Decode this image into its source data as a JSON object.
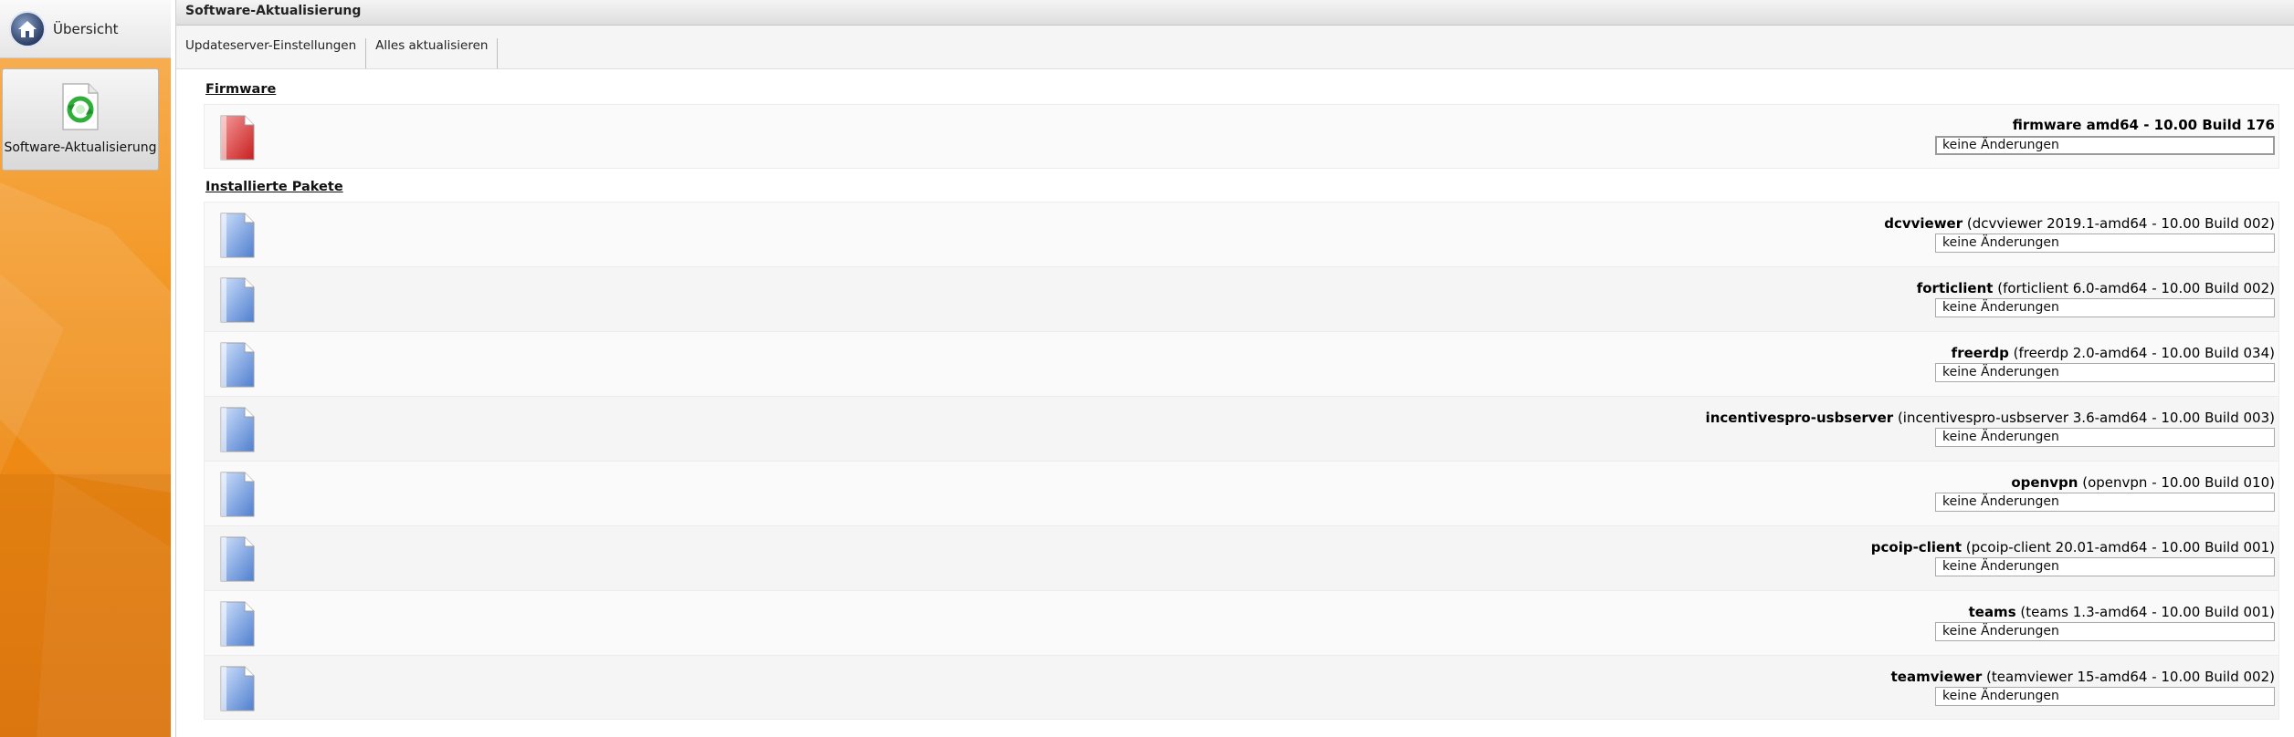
{
  "sidebar": {
    "home_label": "Übersicht",
    "software_update_label": "Software-Aktualisierung"
  },
  "header": {
    "title": "Software-Aktualisierung"
  },
  "toolbar": {
    "updateserver_label": "Updateserver-Einstellungen",
    "update_all_label": "Alles aktualisieren"
  },
  "firmware": {
    "section_title": "Firmware",
    "name": "firmware amd64 - 10.00 Build 176",
    "status": "keine Änderungen"
  },
  "packages": {
    "section_title": "Installierte Pakete",
    "items": [
      {
        "name": "dcvviewer",
        "detail": "(dcvviewer 2019.1-amd64 - 10.00 Build 002)",
        "status": "keine Änderungen"
      },
      {
        "name": "forticlient",
        "detail": "(forticlient 6.0-amd64 - 10.00 Build 002)",
        "status": "keine Änderungen"
      },
      {
        "name": "freerdp",
        "detail": "(freerdp 2.0-amd64 - 10.00 Build 034)",
        "status": "keine Änderungen"
      },
      {
        "name": "incentivespro-usbserver",
        "detail": "(incentivespro-usbserver 3.6-amd64 - 10.00 Build 003)",
        "status": "keine Änderungen"
      },
      {
        "name": "openvpn",
        "detail": "(openvpn - 10.00 Build 010)",
        "status": "keine Änderungen"
      },
      {
        "name": "pcoip-client",
        "detail": "(pcoip-client 20.01-amd64 - 10.00 Build 001)",
        "status": "keine Änderungen"
      },
      {
        "name": "teams",
        "detail": "(teams 1.3-amd64 - 10.00 Build 001)",
        "status": "keine Änderungen"
      },
      {
        "name": "teamviewer",
        "detail": "(teamviewer 15-amd64 - 10.00 Build 002)",
        "status": "keine Änderungen"
      }
    ]
  },
  "icons": {
    "home": "home-icon",
    "software_update": "refresh-icon",
    "firmware": "firmware-file-icon",
    "package": "package-file-icon"
  },
  "colors": {
    "sidebar_orange": "#f39a2a",
    "firmware_red": "#e03a3a",
    "package_blue": "#6f9be0"
  }
}
